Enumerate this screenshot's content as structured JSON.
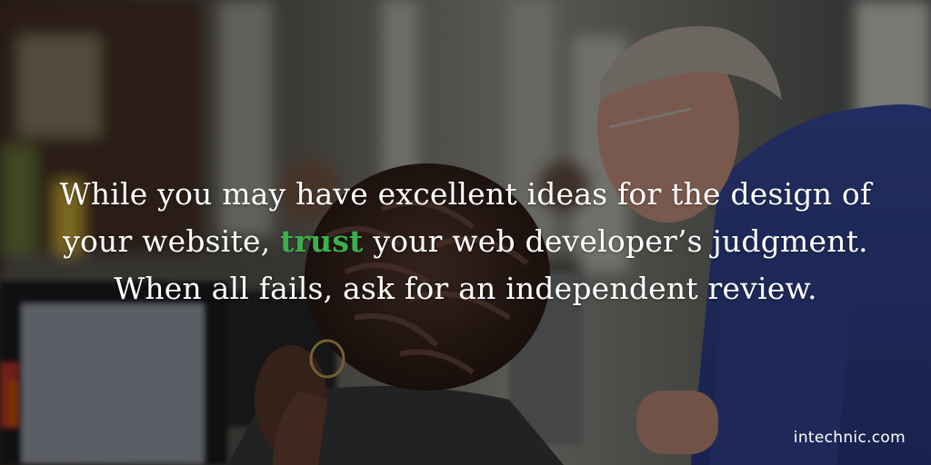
{
  "quote": {
    "line1": "While you may have excellent ideas for the design of",
    "line2_before": "your website, ",
    "line2_highlight": "trust",
    "line2_after": " your web developer’s judgment.",
    "line3": "When all fails, ask for an independent review."
  },
  "brand": {
    "label": "intechnic.com"
  },
  "colors": {
    "highlight": "#39b04a",
    "text": "#ffffff",
    "overlay": "#000000"
  }
}
